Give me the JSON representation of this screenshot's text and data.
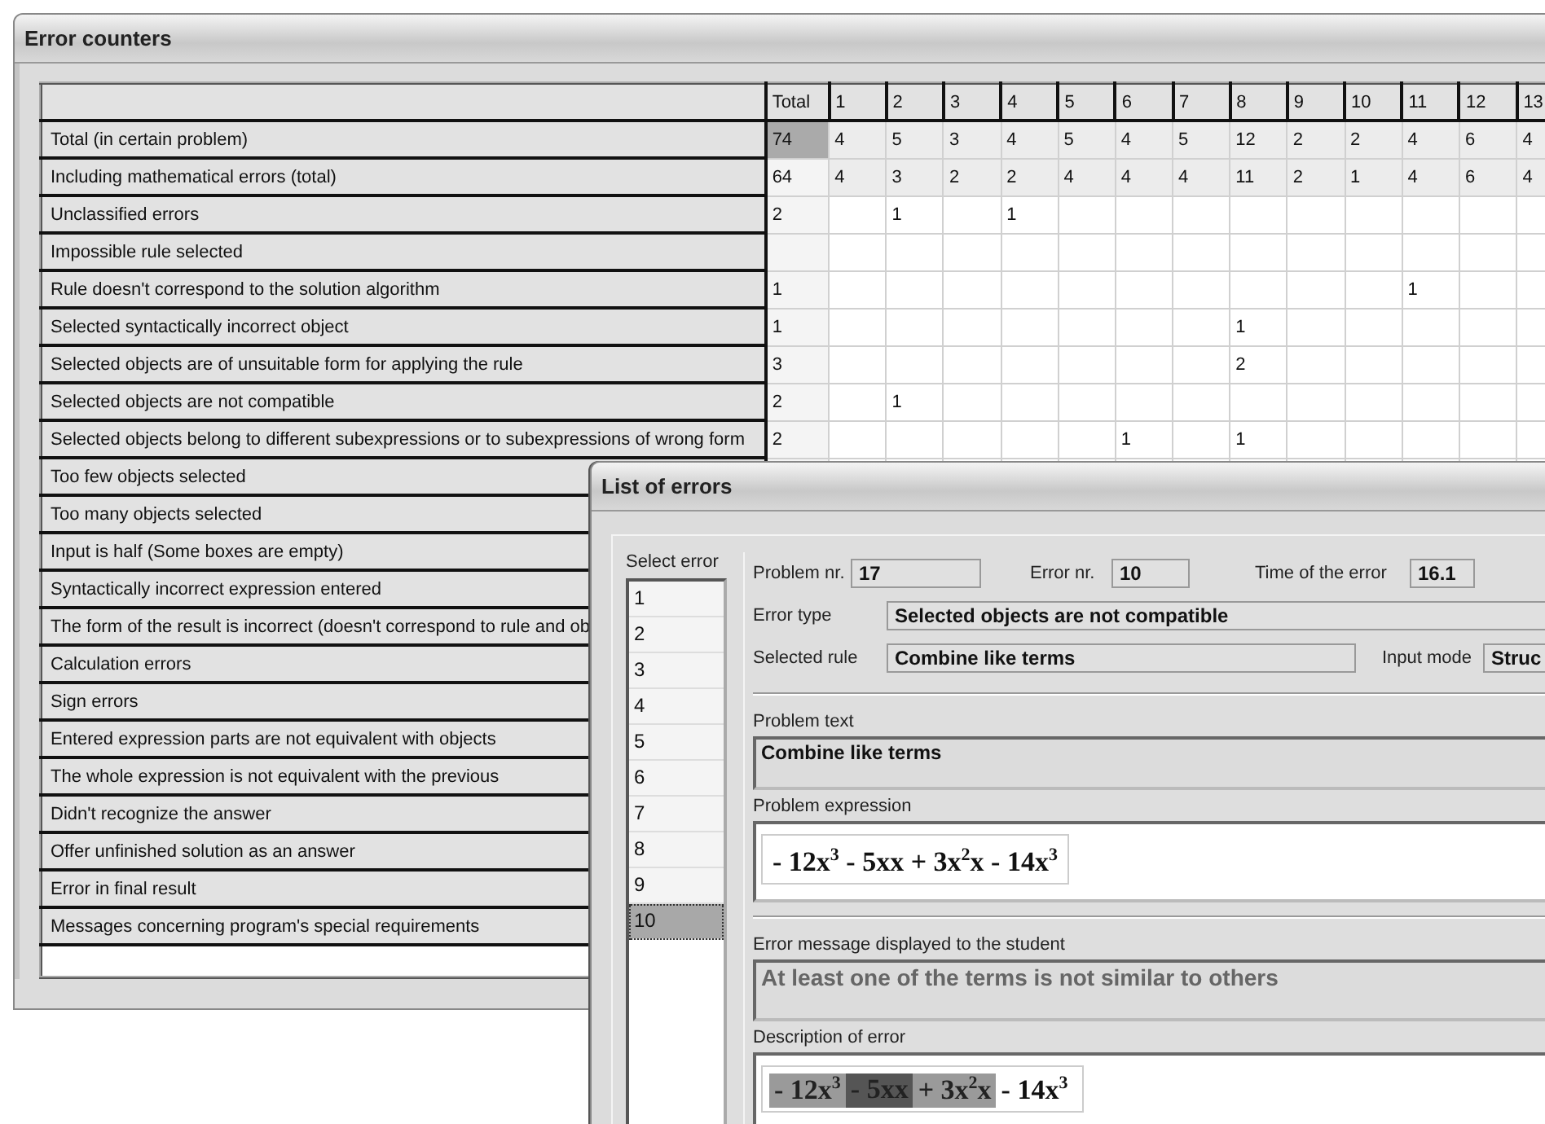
{
  "counters_window": {
    "title": "Error counters",
    "columns": [
      "Total",
      "1",
      "2",
      "3",
      "4",
      "5",
      "6",
      "7",
      "8",
      "9",
      "10",
      "11",
      "12",
      "13"
    ],
    "rows": [
      {
        "label": "Total (in certain problem)",
        "kind": "summary",
        "total_selected": true,
        "cells": [
          "74",
          "4",
          "5",
          "3",
          "4",
          "5",
          "4",
          "5",
          "12",
          "2",
          "2",
          "4",
          "6",
          "4"
        ]
      },
      {
        "label": "Including mathematical errors (total)",
        "kind": "summary",
        "total_selected": false,
        "cells": [
          "64",
          "4",
          "3",
          "2",
          "2",
          "4",
          "4",
          "4",
          "11",
          "2",
          "1",
          "4",
          "6",
          "4"
        ]
      },
      {
        "label": "Unclassified errors",
        "kind": "error",
        "total_selected": false,
        "cells": [
          "2",
          null,
          "1",
          null,
          "1",
          null,
          null,
          null,
          null,
          null,
          null,
          null,
          null,
          null
        ]
      },
      {
        "label": "Impossible rule selected",
        "kind": "error",
        "total_selected": false,
        "cells": [
          null,
          null,
          null,
          null,
          null,
          null,
          null,
          null,
          null,
          null,
          null,
          null,
          null,
          null
        ]
      },
      {
        "label": "Rule doesn't correspond to the solution algorithm",
        "kind": "error",
        "total_selected": false,
        "cells": [
          "1",
          null,
          null,
          null,
          null,
          null,
          null,
          null,
          null,
          null,
          null,
          "1",
          null,
          null
        ]
      },
      {
        "label": "Selected syntactically incorrect object",
        "kind": "error",
        "total_selected": false,
        "cells": [
          "1",
          null,
          null,
          null,
          null,
          null,
          null,
          null,
          "1",
          null,
          null,
          null,
          null,
          null
        ]
      },
      {
        "label": "Selected objects are of unsuitable form for applying the rule",
        "kind": "error",
        "total_selected": false,
        "cells": [
          "3",
          null,
          null,
          null,
          null,
          null,
          null,
          null,
          "2",
          null,
          null,
          null,
          null,
          null
        ]
      },
      {
        "label": "Selected objects are not compatible",
        "kind": "error",
        "total_selected": false,
        "cells": [
          "2",
          null,
          "1",
          null,
          null,
          null,
          null,
          null,
          null,
          null,
          null,
          null,
          null,
          null
        ]
      },
      {
        "label": "Selected objects belong to different subexpressions or to subexpressions of wrong form",
        "kind": "error",
        "total_selected": false,
        "cells": [
          "2",
          null,
          null,
          null,
          null,
          null,
          "1",
          null,
          "1",
          null,
          null,
          null,
          null,
          null
        ]
      },
      {
        "label": "Too few objects selected",
        "kind": "error"
      },
      {
        "label": "Too many objects selected",
        "kind": "error"
      },
      {
        "label": "Input is half (Some boxes are empty)",
        "kind": "error"
      },
      {
        "label": "Syntactically incorrect expression entered",
        "kind": "error"
      },
      {
        "label": "The form of the result is incorrect (doesn't correspond to rule and ob",
        "kind": "error"
      },
      {
        "label": "Calculation errors",
        "kind": "error"
      },
      {
        "label": "Sign errors",
        "kind": "error"
      },
      {
        "label": "Entered expression parts are not equivalent with objects",
        "kind": "error"
      },
      {
        "label": "The whole expression is not equivalent with the previous",
        "kind": "error"
      },
      {
        "label": "Didn't recognize the answer",
        "kind": "error"
      },
      {
        "label": "Offer unfinished solution as an answer",
        "kind": "error"
      },
      {
        "label": "Error in final result",
        "kind": "error"
      },
      {
        "label": "Messages concerning program's special requirements",
        "kind": "error"
      }
    ]
  },
  "errors_dialog": {
    "title": "List of errors",
    "select_label": "Select error",
    "error_list": [
      {
        "label": "1",
        "selected": false
      },
      {
        "label": "2",
        "selected": false
      },
      {
        "label": "3",
        "selected": false
      },
      {
        "label": "4",
        "selected": false
      },
      {
        "label": "5",
        "selected": false
      },
      {
        "label": "6",
        "selected": false
      },
      {
        "label": "7",
        "selected": false
      },
      {
        "label": "8",
        "selected": false
      },
      {
        "label": "9",
        "selected": false
      },
      {
        "label": "10",
        "selected": true
      }
    ],
    "problem_nr": {
      "label": "Problem nr.",
      "value": "17"
    },
    "error_nr": {
      "label": "Error nr.",
      "value": "10"
    },
    "time": {
      "label": "Time of the error",
      "value": "16.1"
    },
    "error_type": {
      "label": "Error type",
      "value": "Selected objects are not compatible"
    },
    "selected_rule": {
      "label": "Selected rule",
      "value": "Combine like terms"
    },
    "input_mode": {
      "label": "Input mode",
      "value": "Struc"
    },
    "problem_text": {
      "label": "Problem text",
      "value": "Combine like terms"
    },
    "problem_expression": {
      "label": "Problem expression",
      "value": "- 12x$^{3}$ - 5xx + 3x$^{2}$x - 14x$^{3}$"
    },
    "error_message": {
      "label": "Error message displayed to the student",
      "value": "At least one of the terms is not similar to others"
    },
    "description": {
      "label": "Description of error",
      "segments": [
        {
          "text": "- 12x$^{3}$",
          "color": "#9a9a9a"
        },
        {
          "text": "- 5xx",
          "color": "#555555"
        },
        {
          "text": "+ 3x$^{2}$x",
          "color": "#9a9a9a"
        },
        {
          "text": "- 14x$^{3}$"
        }
      ]
    }
  }
}
